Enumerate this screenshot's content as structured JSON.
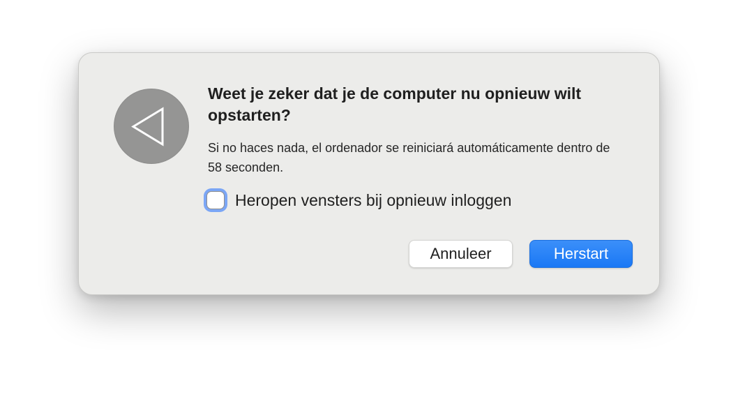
{
  "dialog": {
    "icon": "restart-triangle-icon",
    "title": "Weet je zeker dat je de computer nu opnieuw wilt opstarten?",
    "message": "Si no haces nada, el ordenador se reiniciará automáticamente dentro de 58 seconden.",
    "checkbox": {
      "label": "Heropen vensters bij opnieuw inloggen",
      "checked": false
    },
    "buttons": {
      "cancel_label": "Annuleer",
      "confirm_label": "Herstart"
    }
  },
  "colors": {
    "accent": "#1a78f5",
    "dialog_background": "#ececea",
    "icon_background": "#959594",
    "focus_ring": "#7ba6f5"
  }
}
